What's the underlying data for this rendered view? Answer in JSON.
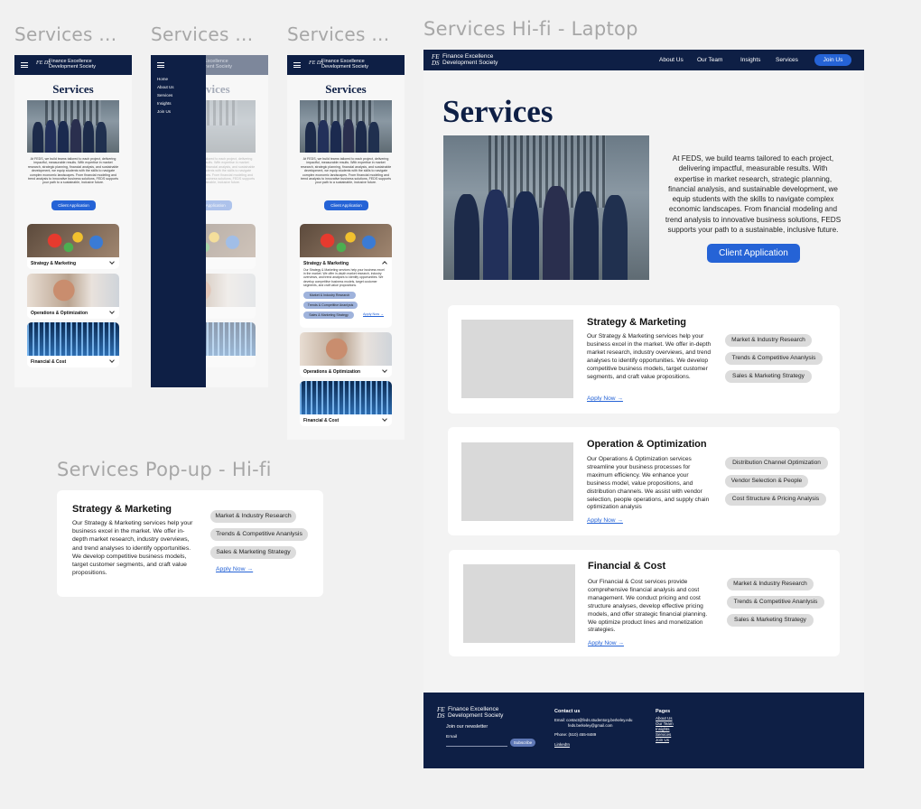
{
  "frames": {
    "mobile_1_title": "Services ...",
    "mobile_2_title": "Services ...",
    "mobile_3_title": "Services ...",
    "laptop_title": "Services Hi-fi - Laptop",
    "popup_title": "Services Pop-up - Hi-fi"
  },
  "brand": {
    "mark": "FE DS",
    "name_line1": "Finance Excellence",
    "name_line2": "Development Society"
  },
  "nav": {
    "items": [
      "About Us",
      "Our Team",
      "Insights",
      "Services"
    ],
    "join_label": "Join Us"
  },
  "mobile_menu": {
    "items": [
      "Home",
      "About Us",
      "Services",
      "Insights",
      "Join Us"
    ]
  },
  "page": {
    "title": "Services",
    "intro": "At FEDS, we build teams tailored to each project, delivering impactful, measurable results. With expertise in market research, strategic planning, financial analysis, and sustainable development, we equip students with the skills to navigate complex economic landscapes. From financial modeling and trend analysis to innovative business solutions, FEDS supports your path to a sustainable, inclusive future.",
    "cta_label": "Client Application"
  },
  "services": [
    {
      "title": "Strategy & Marketing",
      "mobile_title": "Strategy & Marketing",
      "description": "Our Strategy & Marketing services help your business excel in the market. We offer in-depth market research, industry overviews, and trend analyses to identify opportunities. We develop competitive business models, target customer segments, and craft value propositions.",
      "chips": [
        "Market & Industry Research",
        "Trends & Competitive Ananlysis",
        "Sales & Marketing Strategy"
      ],
      "apply_label": "Apply Now →"
    },
    {
      "title": "Operation & Optimization",
      "mobile_title": "Operations & Optimization",
      "description": "Our Operations & Optimization services streamline your business processes for maximum efficiency. We enhance your business model, value propositions, and distribution channels. We assist with vendor selection, people operations, and supply chain optimization analysis",
      "chips": [
        "Distribution Channel Optimization",
        "Vendor Selection & People",
        "Cost Structure & Pricing Analysis"
      ],
      "apply_label": "Apply Now →"
    },
    {
      "title": "Financial & Cost",
      "mobile_title": "Financial & Cost",
      "description": "Our Financial & Cost services provide comprehensive financial analysis and cost management. We conduct pricing and cost structure analyses, develop effective pricing models, and offer strategic financial planning. We optimize product lines and monetization strategies.",
      "chips": [
        "Market & Industry Research",
        "Trends & Competitive Ananlysis",
        "Sales & Marketing Strategy"
      ],
      "apply_label": "Apply Now →"
    }
  ],
  "popup": {
    "title": "Strategy & Marketing",
    "description": "Our Strategy & Marketing services help your business excel in the market. We offer in-depth market research, industry overviews, and trend analyses to identify opportunities. We develop competitive business models, target customer segments, and craft value propositions.",
    "chips": [
      "Market & Industry Research",
      "Trends & Competitive Ananlysis",
      "Sales & Marketing Strategy"
    ],
    "apply_label": "Apply Now →"
  },
  "footer": {
    "newsletter_label": "Join our newsletter",
    "email_label": "Email",
    "subscribe_label": "Subscribe",
    "contact_heading": "Contact us",
    "contact_email": "Email: contact@feds.studentorg.berkeley.edu",
    "contact_email2": "feds.berkeley@gmail.com",
    "contact_phone": "Phone: (510) 455-8489",
    "contact_linkedin": "LinkedIn",
    "pages_heading": "Pages",
    "pages": [
      "About Us",
      "Our Team",
      "Insights",
      "Services",
      "Join Us"
    ]
  },
  "colors": {
    "navy": "#0e1f45",
    "accent_blue": "#2563d6",
    "chip_gray": "#dcdcdc",
    "canvas": "#f1f1f1"
  }
}
